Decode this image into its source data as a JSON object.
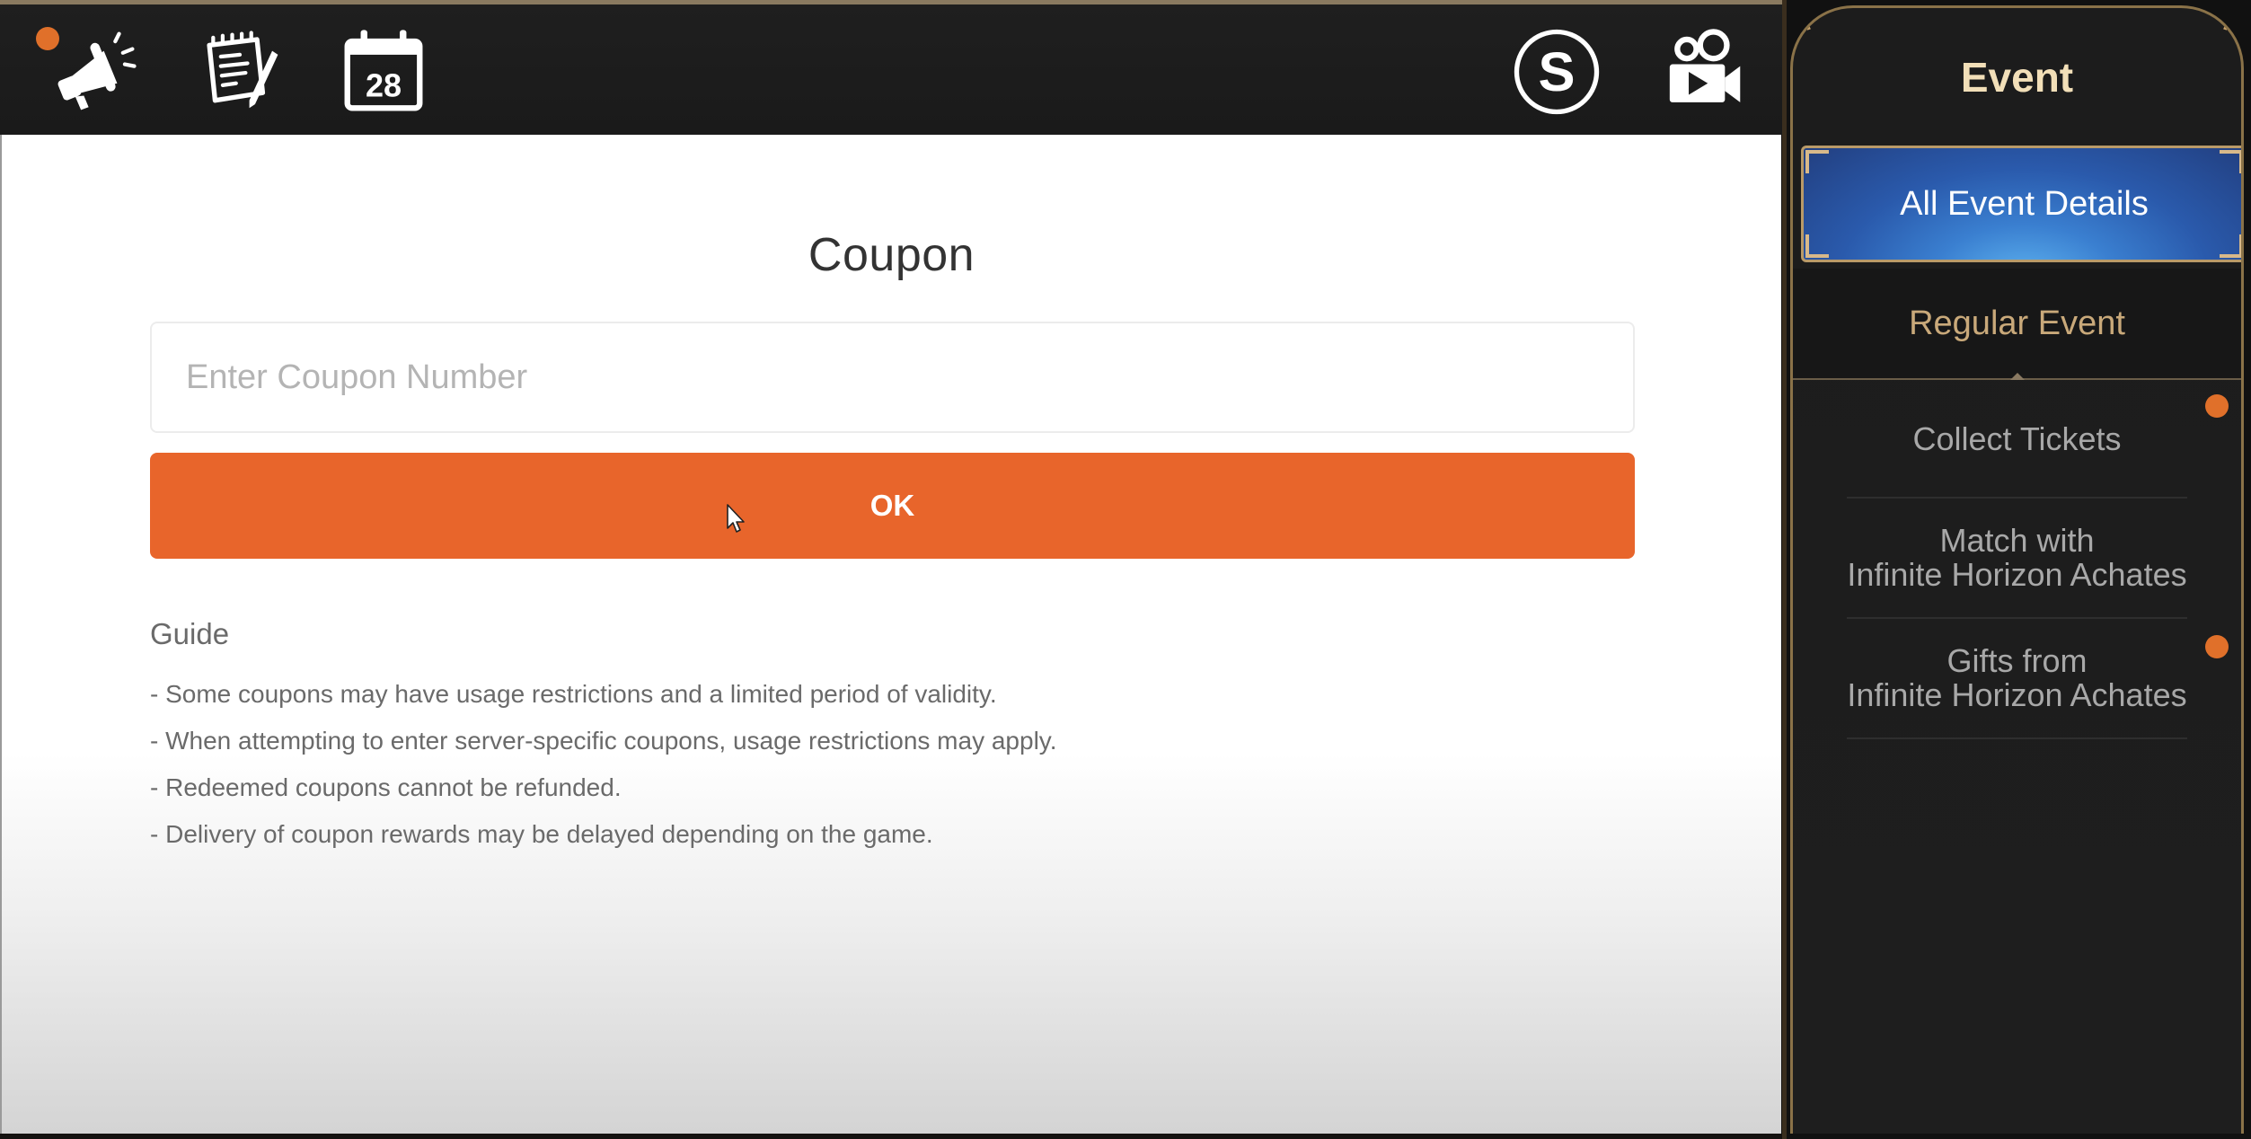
{
  "topbar": {
    "icons": [
      {
        "name": "announcement",
        "icon": "megaphone-icon",
        "has_notification": true
      },
      {
        "name": "notes",
        "icon": "notepad-pencil-icon",
        "has_notification": false
      },
      {
        "name": "calendar",
        "icon": "calendar-icon",
        "date_number": "28",
        "has_notification": false
      },
      {
        "name": "currency",
        "icon": "s-coin-icon",
        "glyph": "S"
      },
      {
        "name": "video",
        "icon": "video-camera-icon"
      }
    ]
  },
  "coupon": {
    "title": "Coupon",
    "input_placeholder": "Enter Coupon Number",
    "input_value": "",
    "ok_label": "OK",
    "guide_title": "Guide",
    "guide_items": [
      "Some coupons may have usage restrictions and a limited period of validity.",
      "When attempting to enter server-specific coupons, usage restrictions may apply.",
      "Redeemed coupons cannot be refunded.",
      "Delivery of coupon rewards may be delayed depending on the game."
    ]
  },
  "event_panel": {
    "title": "Event",
    "all_events_label": "All Event Details",
    "regular_tab_label": "Regular Event",
    "items": [
      {
        "line1": "Collect Tickets",
        "line2": "",
        "has_notification": true
      },
      {
        "line1": "Match with",
        "line2": "Infinite Horizon Achates",
        "has_notification": false
      },
      {
        "line1": "Gifts from",
        "line2": "Infinite Horizon Achates",
        "has_notification": true
      }
    ]
  },
  "colors": {
    "accent_orange": "#e8652b",
    "notification_dot": "#e0702a",
    "gold_text": "#f2dfb8",
    "tab_gold": "#c9a97a",
    "selected_blue": "#2a5aac",
    "panel_dark": "#1c1c1c"
  }
}
